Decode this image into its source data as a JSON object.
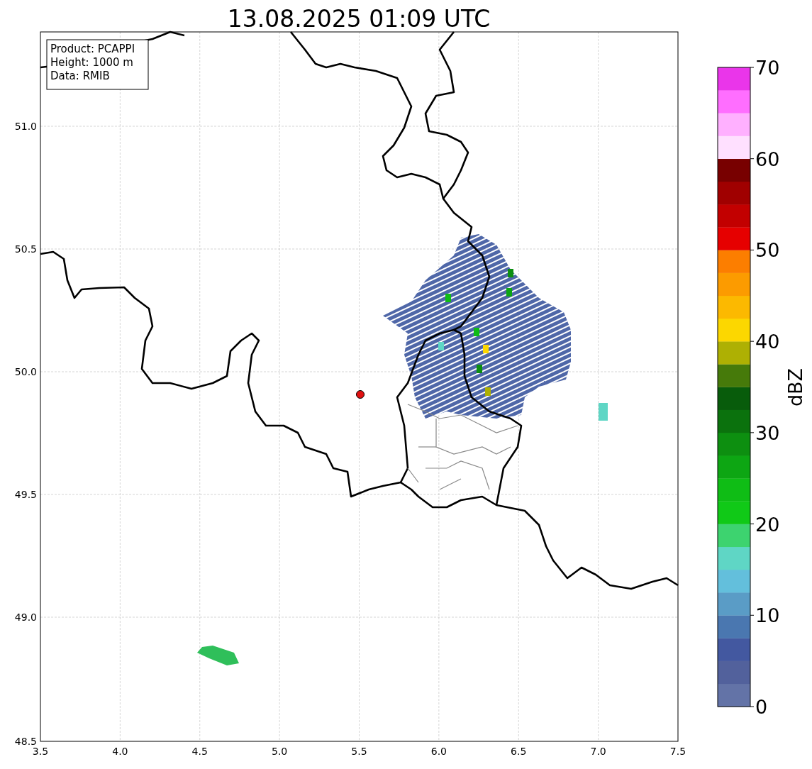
{
  "title": "13.08.2025 01:09 UTC",
  "info": [
    "Product: PCAPPI",
    "Height: 1000 m",
    "Data: RMIB"
  ],
  "map": {
    "xticks": [
      "3.5",
      "4.0",
      "4.5",
      "5.0",
      "5.5",
      "6.0",
      "6.5",
      "7.0",
      "7.5"
    ],
    "yticks": [
      "51.0",
      "50.5",
      "50.0",
      "49.5",
      "49.0",
      "48.5"
    ]
  },
  "colorbar": {
    "label": "dBZ",
    "ticks": [
      "70",
      "60",
      "50",
      "40",
      "30",
      "20",
      "10",
      "0"
    ],
    "bins": [
      {
        "color": "#6373a7"
      },
      {
        "color": "#52619c"
      },
      {
        "color": "#4358a0"
      },
      {
        "color": "#4a77b0"
      },
      {
        "color": "#5a9cc6"
      },
      {
        "color": "#63bfdc"
      },
      {
        "color": "#5fd6c5"
      },
      {
        "color": "#3dd36f"
      },
      {
        "color": "#10c917"
      },
      {
        "color": "#0fbd15"
      },
      {
        "color": "#0da613"
      },
      {
        "color": "#0d8f10"
      },
      {
        "color": "#0b720d"
      },
      {
        "color": "#085c0b"
      },
      {
        "color": "#467a0a"
      },
      {
        "color": "#aeb003"
      },
      {
        "color": "#fcd700"
      },
      {
        "color": "#fcb900"
      },
      {
        "color": "#fc9b00"
      },
      {
        "color": "#fc7e00"
      },
      {
        "color": "#e60000"
      },
      {
        "color": "#c20000"
      },
      {
        "color": "#a00000"
      },
      {
        "color": "#780000"
      },
      {
        "color": "#ffe0ff"
      },
      {
        "color": "#ffb0ff"
      },
      {
        "color": "#ff6eff"
      },
      {
        "color": "#ea35ea"
      }
    ]
  }
}
